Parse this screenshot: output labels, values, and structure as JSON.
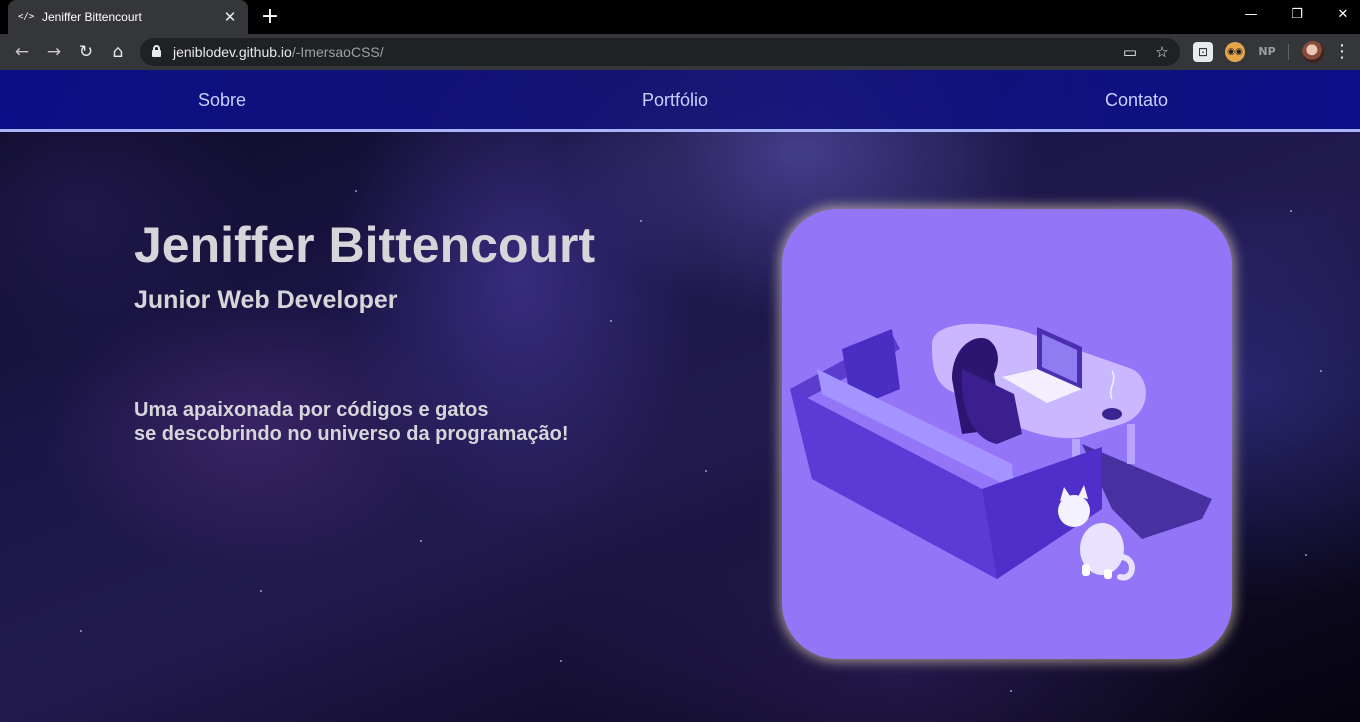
{
  "browser": {
    "tab": {
      "favicon": "</>",
      "title": "Jeniffer Bittencourt",
      "close_icon": "close-icon"
    },
    "new_tab_icon": "plus-icon",
    "window_controls": [
      "minimize-icon",
      "restore-icon",
      "close-icon"
    ],
    "address": {
      "domain": "jeniblodev.github.io",
      "path": "/-ImersaoCSS/"
    },
    "extension_label": "NP"
  },
  "nav": {
    "items": [
      {
        "label": "Sobre"
      },
      {
        "label": "Portfólio"
      },
      {
        "label": "Contato"
      }
    ]
  },
  "hero": {
    "name": "Jeniffer Bittencourt",
    "role": "Junior Web Developer",
    "description_line1": "Uma apaixonada por códigos e gatos",
    "description_line2": "se descobrindo no universo da programação!"
  },
  "colors": {
    "nav_background": "#0d12a0",
    "nav_border": "#a9b4ff",
    "text": "#d6d6da",
    "illustration_background": "#9376f8"
  }
}
